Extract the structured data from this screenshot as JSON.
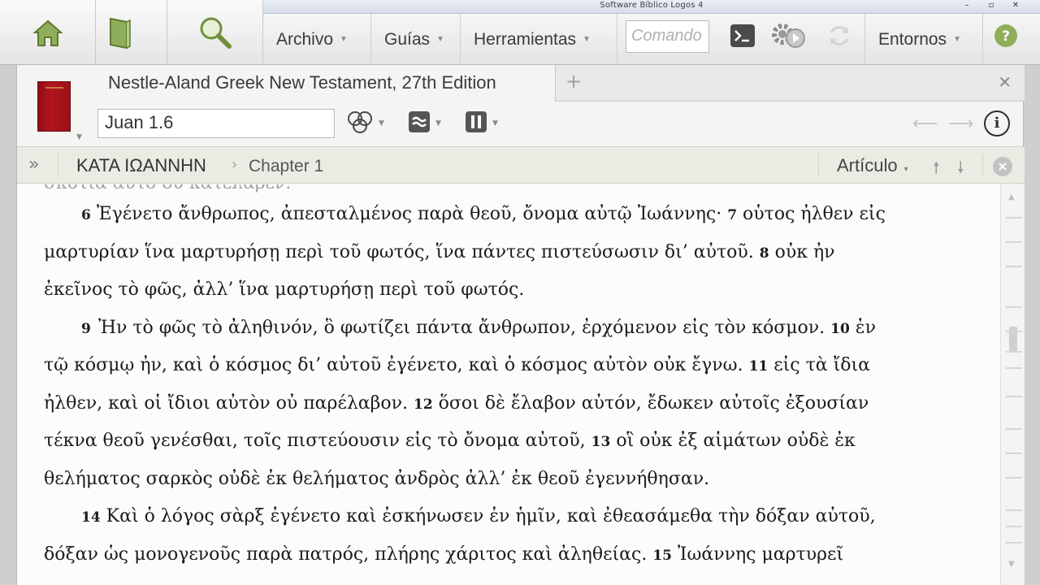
{
  "window": {
    "title": "Software Bíblico Logos 4",
    "controls": [
      "–",
      "▫",
      "✕"
    ]
  },
  "toolbar": {
    "home_icon": "home-icon",
    "library_icon": "library-book-icon",
    "search_icon": "magnifier-icon",
    "menus": [
      "Archivo",
      "Guías",
      "Herramientas"
    ],
    "command_placeholder": "Comando",
    "environments": "Entornos"
  },
  "panel": {
    "tab_title": "Nestle-Aland Greek New Testament, 27th Edition",
    "add_tab": "+",
    "close_tab": "✕",
    "reference": "Juan 1.6",
    "info": "i",
    "breadcrumb": {
      "book": "ΚΑΤΑ ΙΩΑΝΝΗΝ",
      "separator": "›",
      "chapter": "Chapter 1",
      "expand": "»"
    },
    "article_label": "Artículo"
  },
  "text": {
    "partial_line": "σκοτία αὐτὸ οὐ κατέλαβεν.",
    "lines": [
      {
        "indent": true,
        "segments": [
          {
            "v": "6"
          },
          {
            "t": " Ἐγένετο ἄνθρωπος, ἀπεσταλμένος παρὰ θεοῦ, ὄνομα αὐτῷ Ἰωάννης· "
          },
          {
            "v": "7"
          },
          {
            "t": " οὗτος ἦλθεν εἰς"
          }
        ]
      },
      {
        "indent": false,
        "segments": [
          {
            "t": "μαρτυρίαν ἵνα μαρτυρήσῃ περὶ τοῦ φωτός, ἵνα πάντες πιστεύσωσιν δι’ αὐτοῦ. "
          },
          {
            "v": "8"
          },
          {
            "t": " οὐκ ἦν"
          }
        ]
      },
      {
        "indent": false,
        "segments": [
          {
            "t": "ἐκεῖνος τὸ φῶς, ἀλλ’ ἵνα μαρτυρήσῃ περὶ τοῦ φωτός."
          }
        ]
      },
      {
        "indent": true,
        "segments": [
          {
            "v": "9"
          },
          {
            "t": " Ἦν τὸ φῶς τὸ ἀληθινόν, ὃ φωτίζει πάντα ἄνθρωπον, ἐρχόμενον εἰς τὸν κόσμον. "
          },
          {
            "v": "10"
          },
          {
            "t": " ἐν"
          }
        ]
      },
      {
        "indent": false,
        "segments": [
          {
            "t": "τῷ κόσμῳ ἦν, καὶ ὁ κόσμος δι’ αὐτοῦ ἐγένετο, καὶ ὁ κόσμος αὐτὸν οὐκ ἔγνω. "
          },
          {
            "v": "11"
          },
          {
            "t": " εἰς τὰ ἴδια"
          }
        ]
      },
      {
        "indent": false,
        "segments": [
          {
            "t": "ἦλθεν, καὶ οἱ ἴδιοι αὐτὸν οὐ παρέλαβον. "
          },
          {
            "v": "12"
          },
          {
            "t": " ὅσοι δὲ ἔλαβον αὐτόν, ἔδωκεν αὐτοῖς ἐξουσίαν"
          }
        ]
      },
      {
        "indent": false,
        "segments": [
          {
            "t": "τέκνα θεοῦ γενέσθαι, τοῖς πιστεύουσιν εἰς τὸ ὄνομα αὐτοῦ, "
          },
          {
            "v": "13"
          },
          {
            "t": " οἳ οὐκ ἐξ αἱμάτων οὐδὲ ἐκ"
          }
        ]
      },
      {
        "indent": false,
        "segments": [
          {
            "t": "θελήματος σαρκὸς οὐδὲ ἐκ θελήματος ἀνδρὸς ἀλλ’ ἐκ θεοῦ ἐγεννήθησαν."
          }
        ]
      },
      {
        "indent": true,
        "segments": [
          {
            "v": "14"
          },
          {
            "t": " Καὶ ὁ λόγος σὰρξ ἐγένετο καὶ ἐσκήνωσεν ἐν ἡμῖν, καὶ ἐθεασάμεθα τὴν δόξαν αὐτοῦ,"
          }
        ]
      },
      {
        "indent": false,
        "segments": [
          {
            "t": "δόξαν ὡς μονογενοῦς παρὰ πατρός, πλήρης χάριτος καὶ ἀληθείας. "
          },
          {
            "v": "15"
          },
          {
            "t": " Ἰωάννης μαρτυρεῖ"
          }
        ]
      }
    ]
  }
}
